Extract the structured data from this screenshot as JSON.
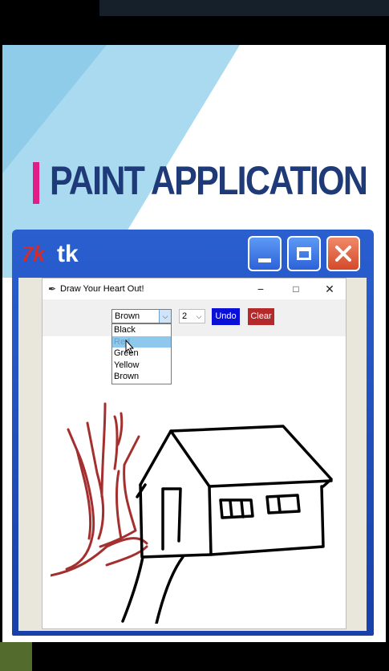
{
  "slide": {
    "heading": "PAINT APPLICATION"
  },
  "outer_window": {
    "title": "tk",
    "logo": "7k"
  },
  "app_window": {
    "title": "Draw Your Heart Out!",
    "icon": "feather-icon",
    "controls": {
      "minimize": "−",
      "maximize": "□",
      "close": "✕"
    }
  },
  "toolbar": {
    "color_select": "Brown",
    "color_options": [
      "Black",
      "Red",
      "Green",
      "Yellow",
      "Brown"
    ],
    "size_select": "2",
    "undo_label": "Undo",
    "clear_label": "Clear"
  },
  "colors": {
    "undo_button": "#0b10d6",
    "clear_button": "#b42a2a",
    "heading": "#1e3a78",
    "accent": "#e11d8a",
    "tree_stroke": "#a3302e",
    "house_stroke": "#000000"
  }
}
